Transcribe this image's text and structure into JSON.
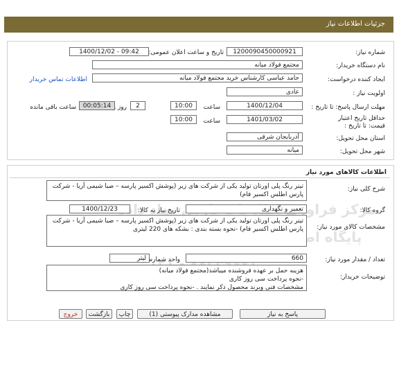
{
  "header": {
    "title": "جزئیات اطلاعات نیاز"
  },
  "fields": {
    "need_number_label": "شماره نیاز:",
    "need_number": "1200090450000921",
    "announce_label": "تاریخ و ساعت اعلان عمومی:",
    "announce_value": "1400/12/02 - 09:42",
    "buyer_org_label": "نام دستگاه خریدار:",
    "buyer_org": "مجتمع فولاد میانه",
    "requester_label": "ایجاد کننده درخواست:",
    "requester": "حامد عباسی کارشناس خرید مجتمع فولاد میانه",
    "contact_link": "اطلاعات تماس خریدار",
    "priority_label": "اولویت نیاز :",
    "priority": "عادی",
    "reply_deadline_label": "مهلت ارسال پاسخ: تا تاریخ :",
    "reply_date": "1400/12/04",
    "time_label": "ساعت",
    "reply_time": "10:00",
    "days": "2",
    "days_label": "روز و",
    "remaining_time": "00:05:14",
    "remaining_label": "ساعت باقی مانده",
    "validity_label": "حداقل تاریخ اعتبار قیمت: تا تاریخ :",
    "validity_date": "1401/03/02",
    "validity_time": "10:00",
    "province_label": "استان محل تحویل:",
    "province": "آذربایجان شرقی",
    "city_label": "شهر محل تحویل:",
    "city": "میانه"
  },
  "goods": {
    "section_title": "اطلاعات کالاهای مورد نیاز",
    "summary_label": "شرح کلی نیاز:",
    "summary": "تینر رنگ پلی اورتان تولید  یکی از شرکت های زیر (پوشش اکسیر پارسه – صبا شیمی آریا -  شرکت پارس اطلس اکسیر فام)",
    "group_label": "گروه کالا:",
    "group": "تعمیر و نگهداری",
    "need_date_label": "تاریخ نیاز به کالا:",
    "need_date": "1400/12/23",
    "specs_label": "مشخصات کالای مورد نیاز:",
    "specs": "تینر رنگ پلی اورتان تولید  یکی از شرکت های زیر (پوشش اکسیر پارسه – صبا شیمی آریا -  شرکت پارس اطلس اکسیر فام) -نحوه بسته بندی  : بشکه های 220 لیتری",
    "qty_label": "تعداد / مقدار مورد نیاز:",
    "qty": "660",
    "unit_label": "واحد شمارش:",
    "unit": "لیتر",
    "notes_label": "توضیحات خریدار:",
    "notes_line1": "هزینه حمل  بر عهده فروشنده میباشد(مجتمع فولاد میانه)",
    "notes_line2": "-نحوه پرداخت سی روز کاری",
    "notes_line3": "مشخصات فنی وبرند محصول ذکر نمایند . -نحوه پرداخت سی روز کاری"
  },
  "buttons": {
    "reply": "پاسخ به نیاز",
    "attachments": "مشاهده مدارک پیوستی (1)",
    "print": "چاپ",
    "back": "بازگشت",
    "exit": "خروج"
  },
  "watermark": {
    "line1": "مرکز فراوری اطلاعات پارس نماد داده",
    "line2": "پایگاه اطلاع رسانی مناقصه و مزایده",
    "line3": "۰۲۱ - ۸۸۳۴۹۶۷۰"
  },
  "colors": {
    "header_bg": "#7a6a33",
    "link": "#1a55c6",
    "exit": "#c62828"
  }
}
